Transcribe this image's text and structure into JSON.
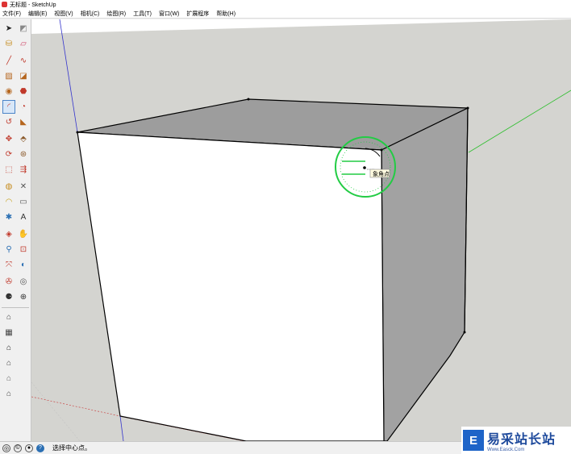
{
  "window": {
    "title": "无标题 - SketchUp"
  },
  "menu": {
    "items": [
      "文件(F)",
      "编辑(E)",
      "视图(V)",
      "相机(C)",
      "绘图(R)",
      "工具(T)",
      "窗口(W)",
      "扩展程序",
      "帮助(H)"
    ]
  },
  "toolbar": {
    "groups": [
      [
        [
          "select-arrow-icon",
          "eraser-paint-icon"
        ],
        [
          "paint-bucket-icon",
          "eraser-icon"
        ]
      ],
      [
        [
          "line-pencil-icon",
          "freehand-icon"
        ],
        [
          "rectangle-icon",
          "rotated-rectangle-icon"
        ],
        [
          "circle-icon",
          "polygon-icon"
        ],
        [
          "arc-icon",
          "pie-icon"
        ],
        [
          "two-point-arc-icon",
          "three-point-arc-icon"
        ]
      ],
      [
        [
          "move-icon",
          "push-pull-icon"
        ],
        [
          "rotate-icon",
          "follow-me-icon"
        ],
        [
          "scale-icon",
          "offset-icon"
        ]
      ],
      [
        [
          "tape-measure-icon",
          "dimension-icon"
        ],
        [
          "protractor-icon",
          "text-label-icon"
        ],
        [
          "axes-icon",
          "3d-text-icon"
        ]
      ],
      [
        [
          "orbit-icon",
          "pan-icon"
        ],
        [
          "zoom-icon",
          "zoom-window-icon"
        ],
        [
          "zoom-extents-icon",
          "previous-view-icon"
        ]
      ],
      [
        [
          "position-camera-icon",
          "look-around-icon"
        ],
        [
          "walk-icon",
          "section-plane-icon"
        ]
      ]
    ],
    "active_tool": "arc-icon",
    "extra": [
      "warehouse-icon",
      "components-icon",
      "home-icon",
      "house-front-icon",
      "house-outline-icon",
      "house-open-icon"
    ]
  },
  "viewport": {
    "tooltip": "象角点",
    "colors": {
      "sky": "#ffffff",
      "ground": "#d4d4d0",
      "front_face": "#ffffff",
      "top_face": "#9d9d9d",
      "right_face": "#a2a2a2",
      "green_axis": "#2fbf2f",
      "blue_axis": "#3333cc",
      "red_axis": "#c83232",
      "protractor": "#22cc44"
    }
  },
  "status": {
    "message": "选择中心点。",
    "icons": [
      "geo-location-icon",
      "credits-icon",
      "user-icon",
      "help-icon"
    ]
  },
  "watermark": {
    "title": "易采站长站",
    "url": "Www.Easck.Com"
  }
}
